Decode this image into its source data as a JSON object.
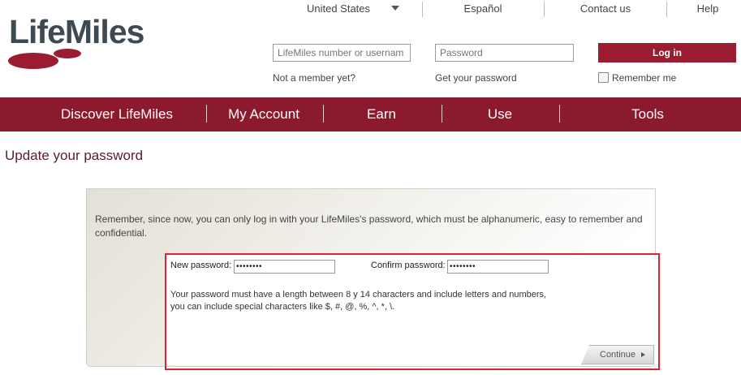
{
  "brand": {
    "logo_text": "LifeMiles",
    "logo_color": "#3e4a52",
    "accent_color": "#8c1a2e"
  },
  "top_links": {
    "country": "United States",
    "language": "Español",
    "contact": "Contact us",
    "help": "Help"
  },
  "login": {
    "username_placeholder": "LifeMiles number or usernam",
    "password_placeholder": "Password",
    "login_button": "Log in",
    "not_member": "Not a member yet?",
    "get_password": "Get your password",
    "remember_me": "Remember me",
    "remember_checked": false
  },
  "nav": {
    "items": [
      "Discover LifeMiles",
      "My Account",
      "Earn",
      "Use",
      "Tools"
    ]
  },
  "page": {
    "title": "Update your password",
    "intro": "Remember, since now, you can only log in with your LifeMiles's password, which must be alphanumeric, easy to remember and confidential.",
    "new_password_label": "New password:",
    "new_password_value": "••••••••",
    "confirm_password_label": "Confirm password:",
    "confirm_password_value": "••••••••",
    "rule_line1": "Your password must have a length between 8 y 14 characters and include letters and numbers,",
    "rule_line2": "you can include special characters like $, #, @, %, ^, *, \\.",
    "continue_button": "Continue"
  },
  "highlight_color": "#e0232a"
}
